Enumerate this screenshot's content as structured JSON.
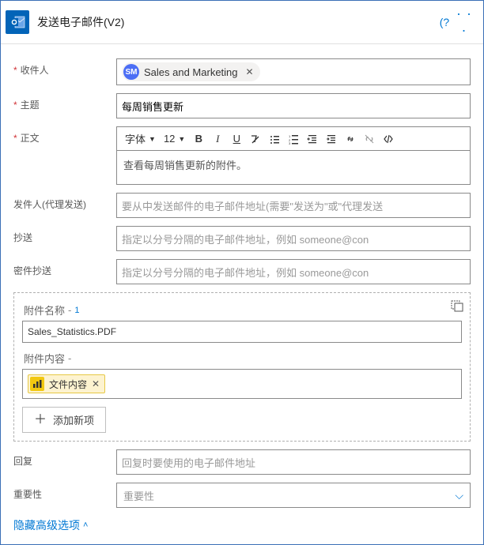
{
  "header": {
    "title": "发送电子邮件(V2)",
    "help_label": "(?",
    "more_label": "· · ·"
  },
  "labels": {
    "to": "收件人",
    "subject": "主题",
    "body": "正文",
    "from": "发件人(代理发送)",
    "cc": "抄送",
    "bcc": "密件抄送",
    "attach_name": "附件名称",
    "attach_content": "附件内容",
    "reply": "回复",
    "importance": "重要性",
    "dash": "-",
    "idx": "1"
  },
  "to": {
    "chip_initials": "SM",
    "chip_label": "Sales and Marketing"
  },
  "subject": {
    "value": "每周销售更新"
  },
  "rte": {
    "font": "字体",
    "size": "12",
    "body_text": "查看每周销售更新的附件。"
  },
  "placeholders": {
    "from": "要从中发送邮件的电子邮件地址(需要\"发送为\"或\"代理发送",
    "cc": "指定以分号分隔的电子邮件地址，例如 someone@con",
    "bcc": "指定以分号分隔的电子邮件地址，例如 someone@con",
    "reply": "回复时要使用的电子邮件地址",
    "importance": "重要性"
  },
  "attach": {
    "filename": "Sales_Statistics.PDF",
    "token_label": "文件内容",
    "add_new": "添加新项"
  },
  "link": {
    "hide_advanced": "隐藏高级选项"
  }
}
